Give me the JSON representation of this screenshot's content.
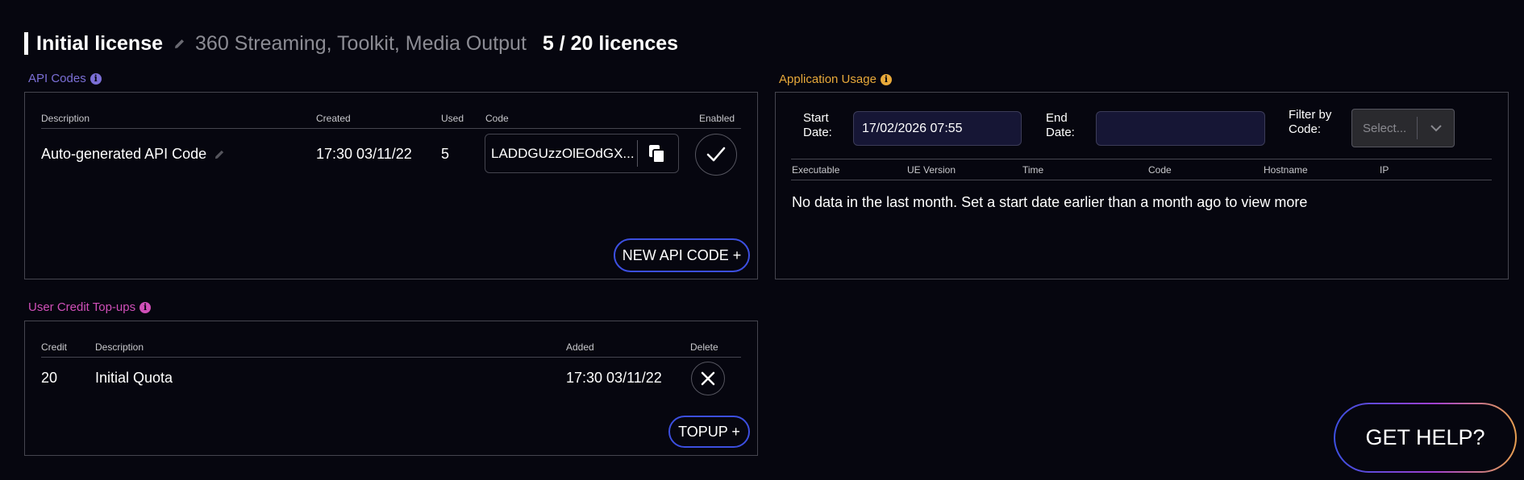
{
  "header": {
    "license_name": "Initial license",
    "products": "360 Streaming, Toolkit, Media Output",
    "licence_count": "5 / 20 licences"
  },
  "api_codes": {
    "label": "API Codes",
    "label_color": "#7b6fd6",
    "columns": {
      "description": "Description",
      "created": "Created",
      "used": "Used",
      "code": "Code",
      "enabled": "Enabled"
    },
    "row": {
      "description": "Auto-generated API Code",
      "created": "17:30 03/11/22",
      "used": "5",
      "code": "LADDGUzzOlEOdGX...",
      "enabled": true
    },
    "new_button": "NEW API CODE +"
  },
  "top_ups": {
    "label": "User Credit Top-ups",
    "label_color": "#d04fb8",
    "columns": {
      "credit": "Credit",
      "description": "Description",
      "added": "Added",
      "delete": "Delete"
    },
    "row": {
      "credit": "20",
      "description": "Initial Quota",
      "added": "17:30 03/11/22"
    },
    "topup_button": "TOPUP +"
  },
  "usage": {
    "label": "Application Usage",
    "label_color": "#e8a93a",
    "start_date_label_1": "Start",
    "start_date_label_2": "Date:",
    "start_date_value": "17/02/2026 07:55",
    "end_date_label_1": "End",
    "end_date_label_2": "Date:",
    "end_date_value": "",
    "filter_label_1": "Filter by",
    "filter_label_2": "Code:",
    "filter_placeholder": "Select...",
    "columns": {
      "executable": "Executable",
      "ue_version": "UE Version",
      "time": "Time",
      "code": "Code",
      "hostname": "Hostname",
      "ip": "IP"
    },
    "empty_message": "No data in the last month. Set a start date earlier than a month ago to view more"
  },
  "help_button": "GET HELP?",
  "icons": {
    "edit": "pencil-icon",
    "info": "info-icon",
    "copy": "copy-icon",
    "enabled": "checkmark-icon",
    "delete": "close-icon",
    "dropdown": "chevron-down-icon"
  }
}
